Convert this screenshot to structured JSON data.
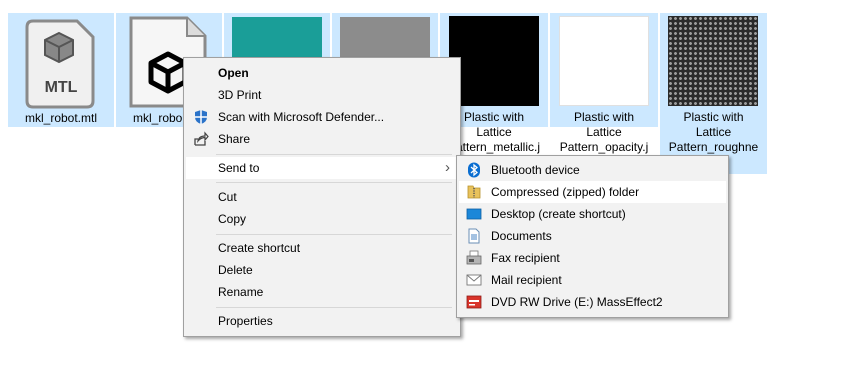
{
  "files": [
    {
      "label": "mkl_robot.mtl",
      "icon_text": "MTL"
    },
    {
      "label": "mkl_robo"
    },
    {
      "label": ""
    },
    {
      "label": ""
    },
    {
      "label": "Plastic with\nLattice\nPattern_metallic.j"
    },
    {
      "label": "Plastic with\nLattice\nPattern_opacity.j"
    },
    {
      "label": "Plastic with\nLattice\nPattern_roughne"
    }
  ],
  "context_menu": {
    "open": "Open",
    "print3d": "3D Print",
    "scan": "Scan with Microsoft Defender...",
    "share": "Share",
    "send_to": "Send to",
    "cut": "Cut",
    "copy": "Copy",
    "create_shortcut": "Create shortcut",
    "delete": "Delete",
    "rename": "Rename",
    "properties": "Properties"
  },
  "send_to_menu": {
    "items": [
      {
        "label": "Bluetooth device",
        "icon": "bluetooth-icon"
      },
      {
        "label": "Compressed (zipped) folder",
        "icon": "zip-folder-icon"
      },
      {
        "label": "Desktop (create shortcut)",
        "icon": "desktop-icon"
      },
      {
        "label": "Documents",
        "icon": "documents-icon"
      },
      {
        "label": "Fax recipient",
        "icon": "fax-icon"
      },
      {
        "label": "Mail recipient",
        "icon": "mail-icon"
      },
      {
        "label": "DVD RW Drive (E:) MassEffect2",
        "icon": "dvd-drive-icon"
      }
    ]
  },
  "colors": {
    "selection": "#cce8ff",
    "teal_swatch": "#1a9e98",
    "gray_swatch": "#8c8c8c",
    "bluetooth": "#0a6ed1"
  }
}
